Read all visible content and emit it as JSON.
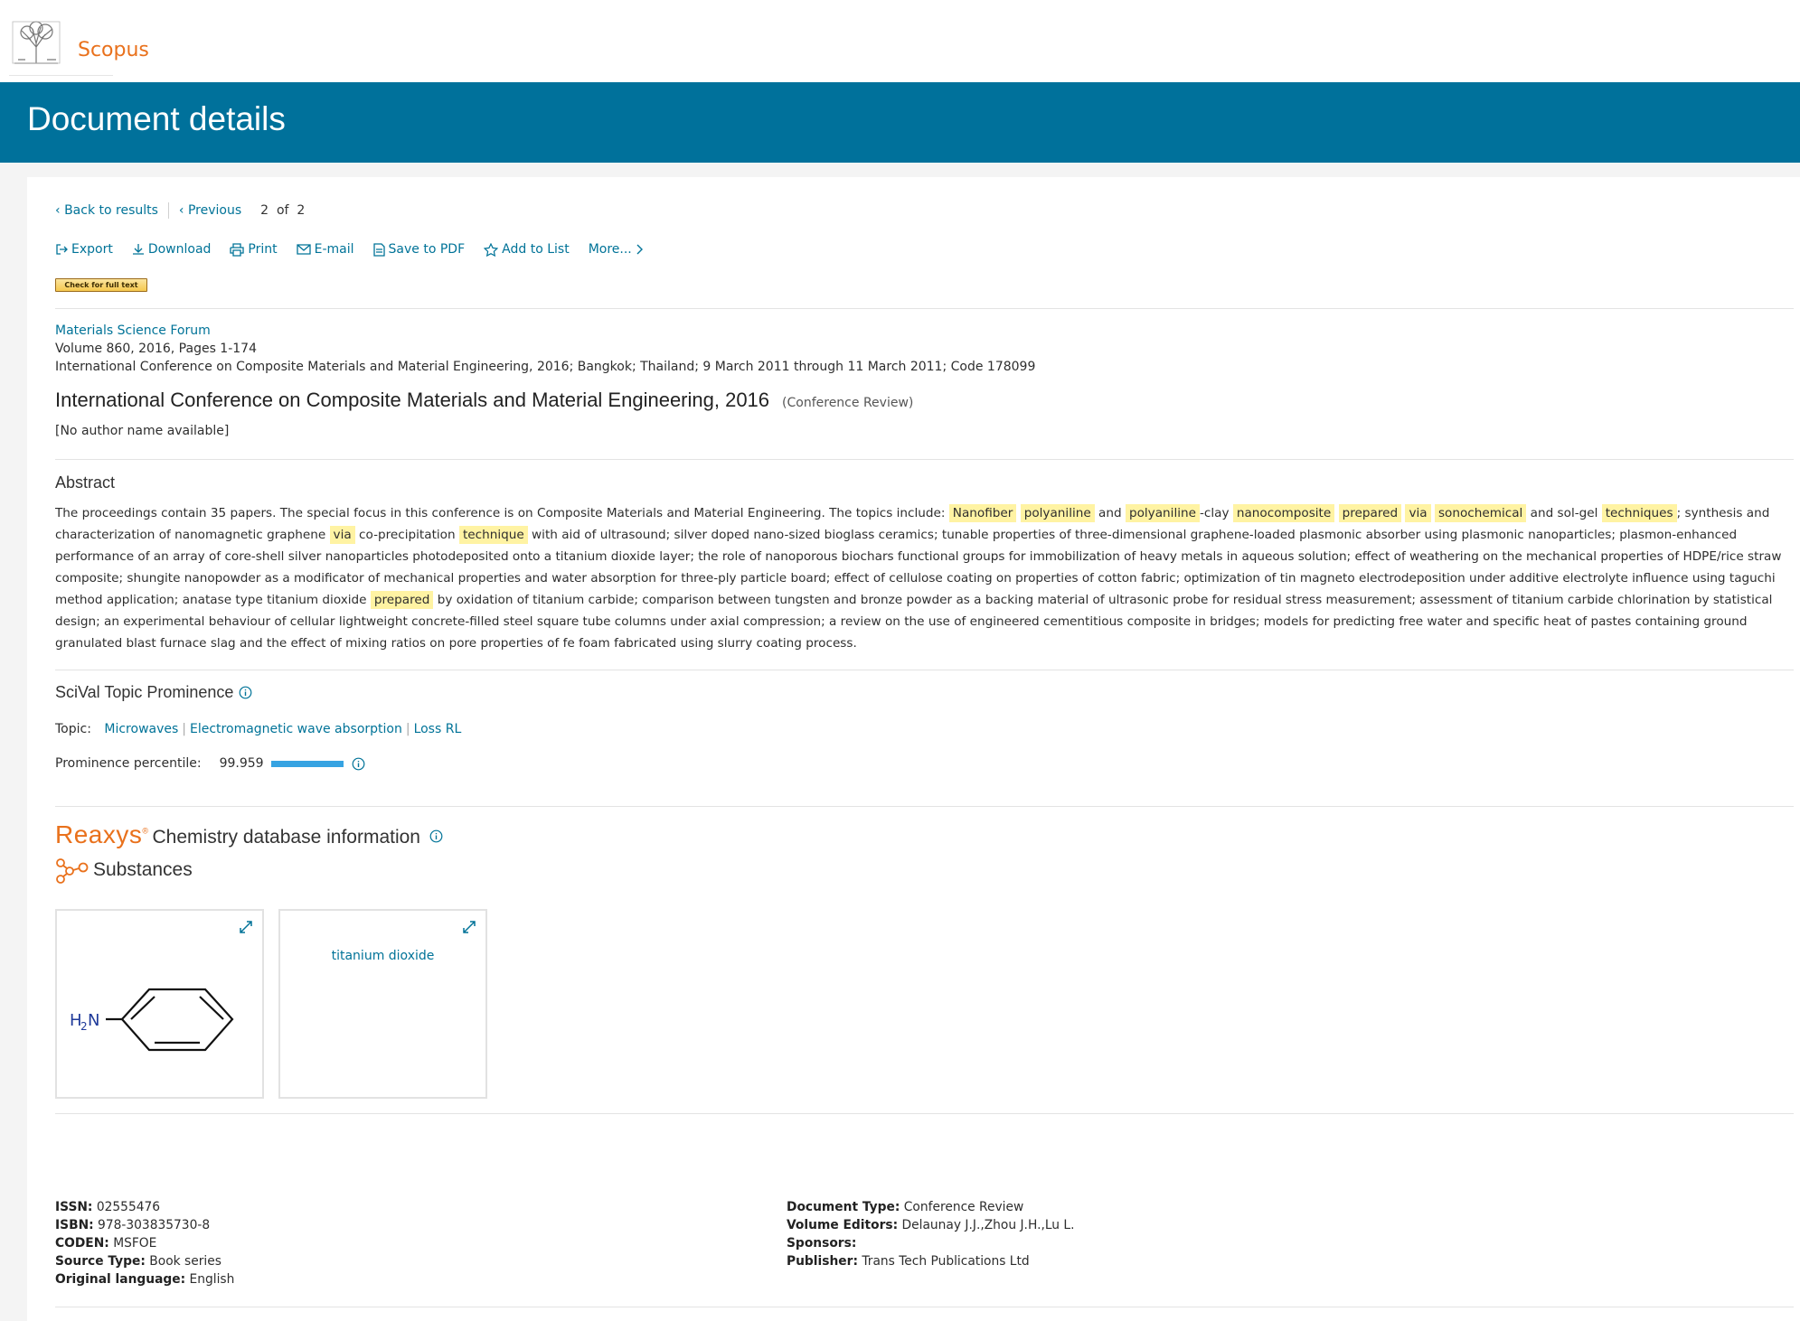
{
  "header": {
    "brand": "Scopus",
    "page_title": "Document details"
  },
  "nav": {
    "back": "Back to results",
    "previous": "Previous",
    "current": "2",
    "of_label": "of",
    "total": "2"
  },
  "tools": [
    {
      "label": "Export",
      "icon": "export-icon"
    },
    {
      "label": "Download",
      "icon": "download-icon"
    },
    {
      "label": "Print",
      "icon": "print-icon"
    },
    {
      "label": "E-mail",
      "icon": "email-icon"
    },
    {
      "label": "Save to PDF",
      "icon": "pdf-icon"
    },
    {
      "label": "Add to List",
      "icon": "star-icon"
    },
    {
      "label": "More...",
      "icon": "chevron-right-icon"
    }
  ],
  "check_full_text": "Check for full text",
  "source": {
    "journal": "Materials Science Forum",
    "volume_line": "Volume 860, 2016, Pages 1-174",
    "conference_line": "International Conference on Composite Materials and Material Engineering, 2016; Bangkok; Thailand; 9 March 2011 through 11 March 2011; Code 178099"
  },
  "document": {
    "title": "International Conference on Composite Materials and Material Engineering, 2016",
    "type_badge": "(Conference Review)",
    "authors": "[No author name available]"
  },
  "abstract": {
    "heading": "Abstract",
    "segments": [
      {
        "t": "The proceedings contain 35 papers. The special focus in this conference is on Composite Materials and Material Engineering. The topics include: "
      },
      {
        "t": "Nanofiber",
        "hl": true
      },
      {
        "t": " "
      },
      {
        "t": "polyaniline",
        "hl": true
      },
      {
        "t": " and "
      },
      {
        "t": "polyaniline",
        "hl": true
      },
      {
        "t": "-clay "
      },
      {
        "t": "nanocomposite",
        "hl": true
      },
      {
        "t": " "
      },
      {
        "t": "prepared",
        "hl": true
      },
      {
        "t": " "
      },
      {
        "t": "via",
        "hl": true
      },
      {
        "t": " "
      },
      {
        "t": "sonochemical",
        "hl": true
      },
      {
        "t": " and sol-gel "
      },
      {
        "t": "techniques",
        "hl": true
      },
      {
        "t": "; synthesis and characterization of nanomagnetic graphene "
      },
      {
        "t": "via",
        "hl": true
      },
      {
        "t": " co-precipitation "
      },
      {
        "t": "technique",
        "hl": true
      },
      {
        "t": " with aid of ultrasound; silver doped nano-sized bioglass ceramics; tunable properties of three-dimensional graphene-loaded plasmonic absorber using plasmonic nanoparticles; plasmon-enhanced performance of an array of core-shell silver nanoparticles photodeposited onto a titanium dioxide layer; the role of nanoporous biochars functional groups for immobilization of heavy metals in aqueous solution; effect of weathering on the mechanical properties of HDPE/rice straw composite; shungite nanopowder as a modificator of mechanical properties and water absorption for three-ply particle board; effect of cellulose coating on properties of cotton fabric; optimization of tin magneto electrodeposition under additive electrolyte influence using taguchi method application; anatase type titanium dioxide "
      },
      {
        "t": "prepared",
        "hl": true
      },
      {
        "t": " by oxidation of titanium carbide; comparison between tungsten and bronze powder as a backing material of ultrasonic probe for residual stress measurement; assessment of titanium carbide chlorination by statistical design; an experimental behaviour of cellular lightweight concrete-filled steel square tube columns under axial compression; a review on the use of engineered cementitious composite in bridges; models for predicting free water and specific heat of pastes containing ground granulated blast furnace slag and the effect of mixing ratios on pore properties of fe foam fabricated using slurry coating process."
      }
    ]
  },
  "scival": {
    "heading": "SciVal Topic Prominence",
    "topic_label": "Topic:",
    "topics": [
      "Microwaves",
      "Electromagnetic wave absorption",
      "Loss RL"
    ],
    "prominence_label": "Prominence percentile:",
    "prominence_value": "99.959",
    "prominence_fraction": 0.99959
  },
  "reaxys": {
    "logo": "Reaxys",
    "title": "Chemistry database information",
    "substances_heading": "Substances",
    "substances": [
      {
        "kind": "structure",
        "label_prefix": "H",
        "label_sub": "2",
        "label_suffix": "N"
      },
      {
        "kind": "name",
        "name": "titanium dioxide"
      }
    ]
  },
  "details_left": [
    {
      "k": "ISSN:",
      "v": "02555476"
    },
    {
      "k": "ISBN:",
      "v": "978-303835730-8"
    },
    {
      "k": "CODEN:",
      "v": "MSFOE"
    },
    {
      "k": "Source Type:",
      "v": "Book series"
    },
    {
      "k": "Original language:",
      "v": "English"
    }
  ],
  "details_right": [
    {
      "k": "Document Type:",
      "v": "Conference Review"
    },
    {
      "k": "Volume Editors:",
      "v": "Delaunay J.J.,Zhou J.H.,Lu L."
    },
    {
      "k": "Sponsors:",
      "v": ""
    },
    {
      "k": "Publisher:",
      "v": "Trans Tech Publications Ltd"
    }
  ],
  "colors": {
    "brand_orange": "#e9711c",
    "banner_blue": "#00719b",
    "link": "#007398",
    "highlight": "#fff3a3"
  }
}
